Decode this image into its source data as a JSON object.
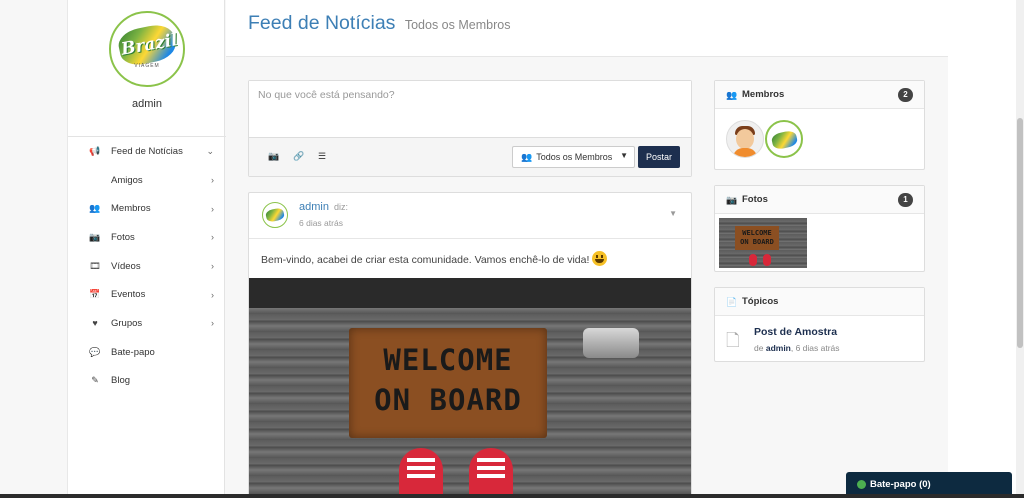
{
  "sidebar": {
    "username": "admin",
    "logo": {
      "text": "Brazil",
      "subtext": "VIAGEM"
    },
    "items": [
      {
        "label": "Feed de Notícias",
        "icon": "megaphone-icon",
        "chevron": "⌄"
      },
      {
        "label": "Amigos",
        "icon": "",
        "chevron": "›"
      },
      {
        "label": "Membros",
        "icon": "users-icon",
        "chevron": "›"
      },
      {
        "label": "Fotos",
        "icon": "camera-icon",
        "chevron": "›"
      },
      {
        "label": "Vídeos",
        "icon": "film-icon",
        "chevron": "›"
      },
      {
        "label": "Eventos",
        "icon": "calendar-icon",
        "chevron": "›"
      },
      {
        "label": "Grupos",
        "icon": "heart-icon",
        "chevron": "›"
      },
      {
        "label": "Bate-papo",
        "icon": "chat-icon",
        "chevron": ""
      },
      {
        "label": "Blog",
        "icon": "edit-icon",
        "chevron": ""
      }
    ]
  },
  "header": {
    "title": "Feed de Notícias",
    "subtitle": "Todos os Membros"
  },
  "composer": {
    "placeholder": "No que você está pensando?",
    "privacy_label": "Todos os Membros",
    "post_label": "Postar"
  },
  "post": {
    "author": "admin",
    "says": "diz:",
    "time": "6 dias atrás",
    "text": "Bem-vindo, acabei de criar esta comunidade. Vamos enchê-lo de vida!",
    "image_text_line1": "WELCOME",
    "image_text_line2": "ON BOARD"
  },
  "widgets": {
    "members": {
      "title": "Membros",
      "count": "2"
    },
    "photos": {
      "title": "Fotos",
      "count": "1"
    },
    "topics": {
      "title": "Tópicos",
      "item_title": "Post de Amostra",
      "item_by": "de",
      "item_author": "admin",
      "item_time": ", 6 dias atrás"
    }
  },
  "chat": {
    "label": "Bate-papo (0)"
  },
  "colors": {
    "accent": "#3d7fb5",
    "brand_dark": "#1d2f4f",
    "online": "#4caf50",
    "avatar_ring": "#8bc34a"
  }
}
